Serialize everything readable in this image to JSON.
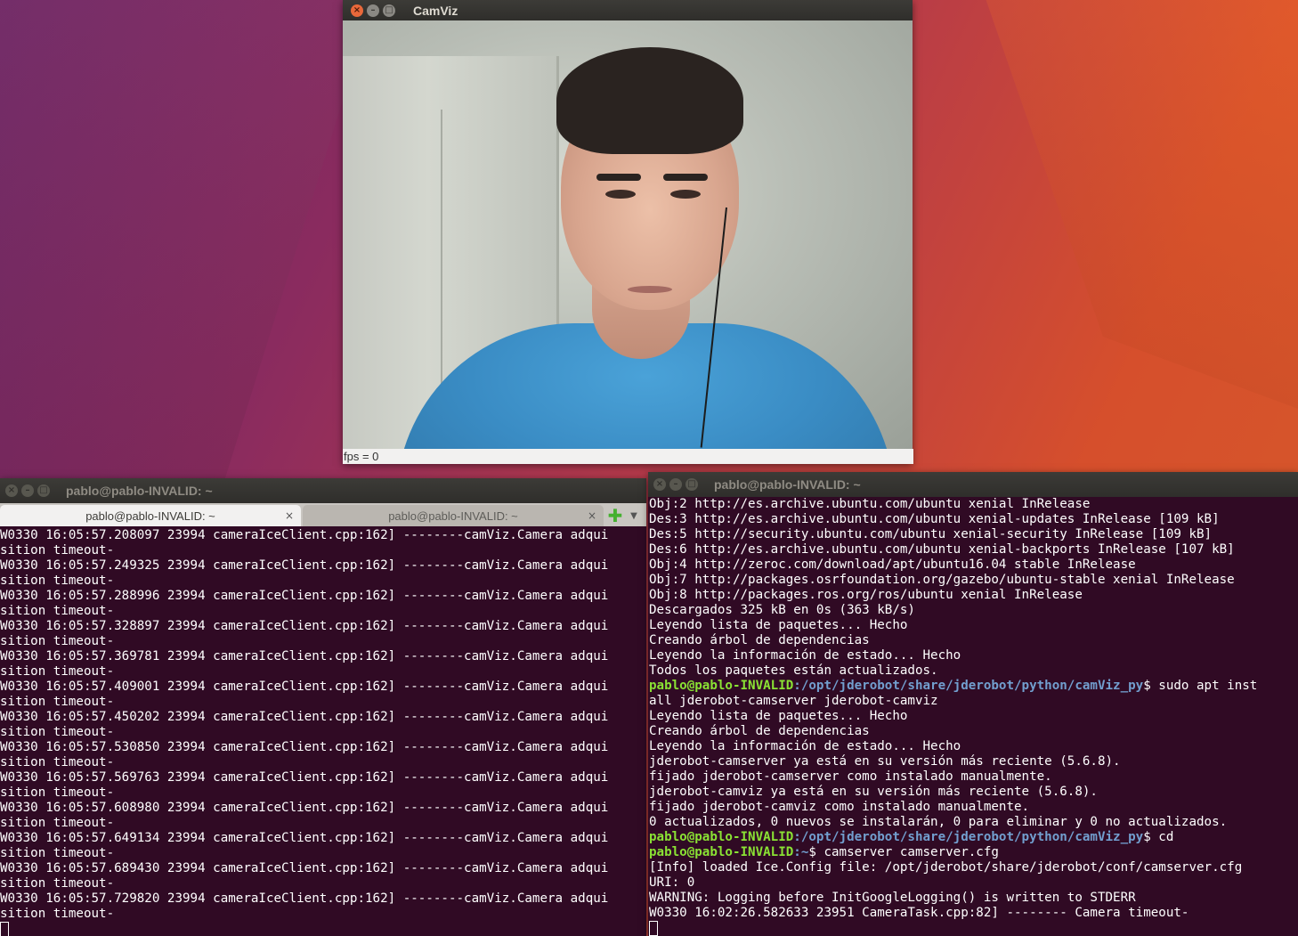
{
  "camviz": {
    "title": "CamViz",
    "status": "fps = 0"
  },
  "term_left": {
    "title": "pablo@pablo-INVALID: ~",
    "tabs": [
      {
        "label": "pablo@pablo-INVALID: ~",
        "active": true
      },
      {
        "label": "pablo@pablo-INVALID: ~",
        "active": false
      }
    ],
    "lines": [
      "W0330 16:05:57.208097 23994 cameraIceClient.cpp:162] --------camViz.Camera adqui",
      "sition timeout-",
      "W0330 16:05:57.249325 23994 cameraIceClient.cpp:162] --------camViz.Camera adqui",
      "sition timeout-",
      "W0330 16:05:57.288996 23994 cameraIceClient.cpp:162] --------camViz.Camera adqui",
      "sition timeout-",
      "W0330 16:05:57.328897 23994 cameraIceClient.cpp:162] --------camViz.Camera adqui",
      "sition timeout-",
      "W0330 16:05:57.369781 23994 cameraIceClient.cpp:162] --------camViz.Camera adqui",
      "sition timeout-",
      "W0330 16:05:57.409001 23994 cameraIceClient.cpp:162] --------camViz.Camera adqui",
      "sition timeout-",
      "W0330 16:05:57.450202 23994 cameraIceClient.cpp:162] --------camViz.Camera adqui",
      "sition timeout-",
      "W0330 16:05:57.530850 23994 cameraIceClient.cpp:162] --------camViz.Camera adqui",
      "sition timeout-",
      "W0330 16:05:57.569763 23994 cameraIceClient.cpp:162] --------camViz.Camera adqui",
      "sition timeout-",
      "W0330 16:05:57.608980 23994 cameraIceClient.cpp:162] --------camViz.Camera adqui",
      "sition timeout-",
      "W0330 16:05:57.649134 23994 cameraIceClient.cpp:162] --------camViz.Camera adqui",
      "sition timeout-",
      "W0330 16:05:57.689430 23994 cameraIceClient.cpp:162] --------camViz.Camera adqui",
      "sition timeout-",
      "W0330 16:05:57.729820 23994 cameraIceClient.cpp:162] --------camViz.Camera adqui",
      "sition timeout-"
    ]
  },
  "term_right": {
    "title": "pablo@pablo-INVALID: ~",
    "lines": [
      {
        "text": "Obj:2 http://es.archive.ubuntu.com/ubuntu xenial InRelease"
      },
      {
        "text": "Des:3 http://es.archive.ubuntu.com/ubuntu xenial-updates InRelease [109 kB]"
      },
      {
        "text": "Des:5 http://security.ubuntu.com/ubuntu xenial-security InRelease [109 kB]"
      },
      {
        "text": "Des:6 http://es.archive.ubuntu.com/ubuntu xenial-backports InRelease [107 kB]"
      },
      {
        "text": "Obj:4 http://zeroc.com/download/apt/ubuntu16.04 stable InRelease"
      },
      {
        "text": "Obj:7 http://packages.osrfoundation.org/gazebo/ubuntu-stable xenial InRelease"
      },
      {
        "text": "Obj:8 http://packages.ros.org/ros/ubuntu xenial InRelease"
      },
      {
        "text": "Descargados 325 kB en 0s (363 kB/s)"
      },
      {
        "text": "Leyendo lista de paquetes... Hecho"
      },
      {
        "text": "Creando árbol de dependencias"
      },
      {
        "text": "Leyendo la información de estado... Hecho"
      },
      {
        "text": "Todos los paquetes están actualizados."
      },
      {
        "user": "pablo@pablo-INVALID",
        "path": ":/opt/jderobot/share/jderobot/python/camViz_py",
        "cmd": "$ sudo apt inst"
      },
      {
        "text": "all jderobot-camserver jderobot-camviz"
      },
      {
        "text": "Leyendo lista de paquetes... Hecho"
      },
      {
        "text": "Creando árbol de dependencias"
      },
      {
        "text": "Leyendo la información de estado... Hecho"
      },
      {
        "text": "jderobot-camserver ya está en su versión más reciente (5.6.8)."
      },
      {
        "text": "fijado jderobot-camserver como instalado manualmente."
      },
      {
        "text": "jderobot-camviz ya está en su versión más reciente (5.6.8)."
      },
      {
        "text": "fijado jderobot-camviz como instalado manualmente."
      },
      {
        "text": "0 actualizados, 0 nuevos se instalarán, 0 para eliminar y 0 no actualizados."
      },
      {
        "user": "pablo@pablo-INVALID",
        "path": ":/opt/jderobot/share/jderobot/python/camViz_py",
        "cmd": "$ cd"
      },
      {
        "user": "pablo@pablo-INVALID",
        "path": ":~",
        "cmd": "$ camserver camserver.cfg"
      },
      {
        "text": "[Info] loaded Ice.Config file: /opt/jderobot/share/jderobot/conf/camserver.cfg"
      },
      {
        "text": "URI: 0"
      },
      {
        "text": "WARNING: Logging before InitGoogleLogging() is written to STDERR"
      },
      {
        "text": "W0330 16:02:26.582633 23951 CameraTask.cpp:82] -------- Camera timeout-"
      }
    ]
  },
  "icons": {
    "close": "close-icon",
    "minimize": "minimize-icon",
    "maximize": "maximize-icon",
    "tab_add": "plus-icon",
    "tab_menu": "chevron-down-icon"
  },
  "colors": {
    "terminal_bg": "#300a24",
    "prompt_user": "#8ae234",
    "prompt_path": "#729fcf",
    "accent_close": "#e9683a"
  }
}
